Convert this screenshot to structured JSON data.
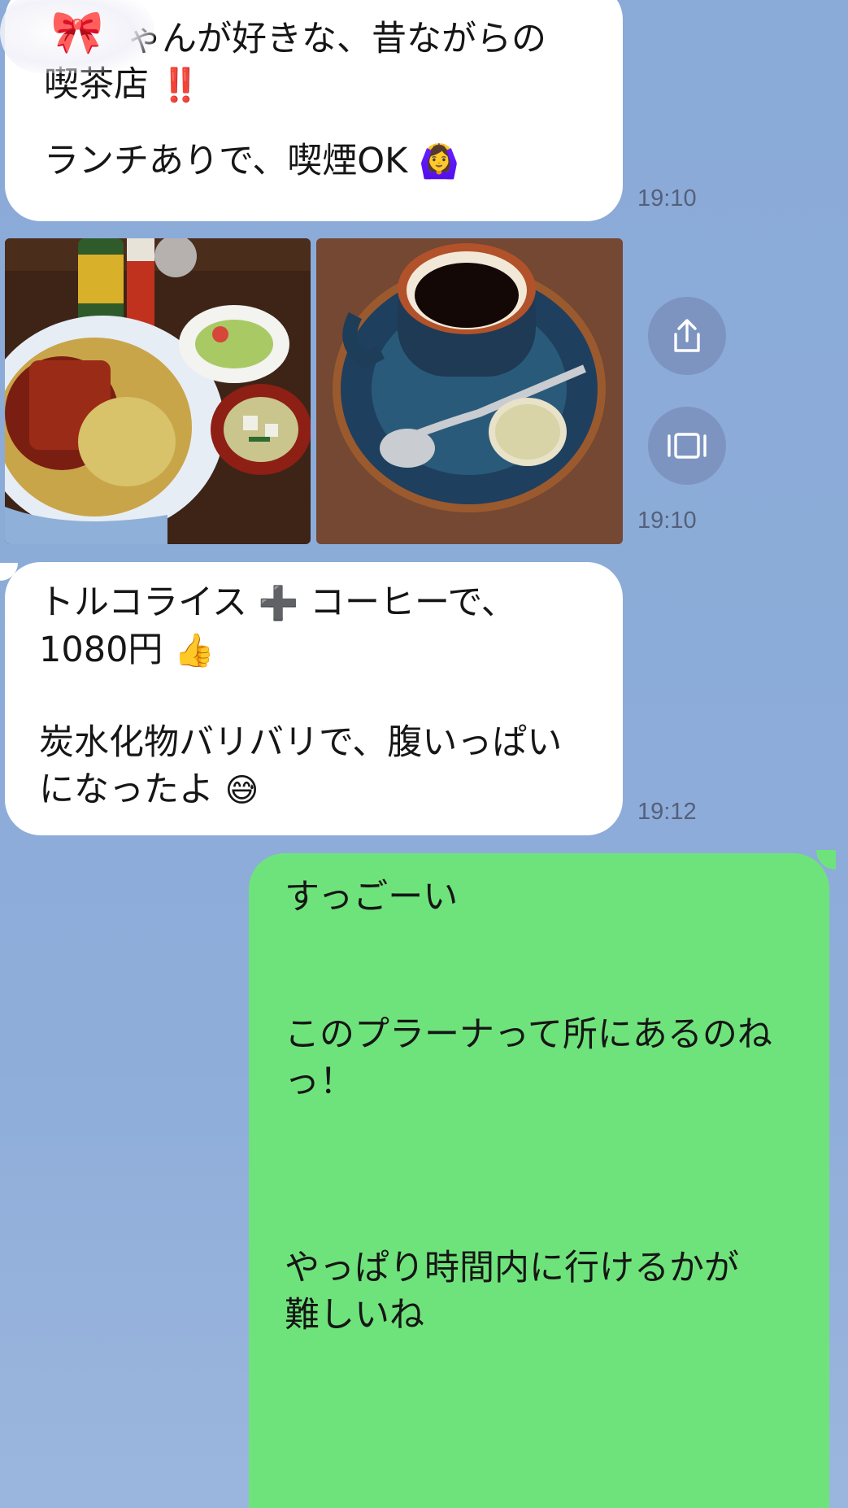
{
  "messages": [
    {
      "direction": "incoming",
      "line1": "ゃんが好きな、昔ながらの",
      "line2": "喫茶店",
      "line2_mark": "‼️",
      "line3": "ランチありで、喫煙OK",
      "line3_emoji": "🙆‍♀️",
      "sticker_emoji": "🎀",
      "time": "19:10"
    },
    {
      "direction": "incoming",
      "type": "photos",
      "photos": [
        "photo-turkish-rice",
        "photo-coffee"
      ],
      "time": "19:10"
    },
    {
      "direction": "incoming",
      "line1a": "トルコライス",
      "line1_emoji": "➕",
      "line1b": "コーヒーで、",
      "line2": "1080円",
      "line2_emoji": "👍",
      "line3": "炭水化物バリバリで、腹いっぱい",
      "line4": "になったよ",
      "line4_emoji": "😅",
      "time": "19:12"
    },
    {
      "direction": "outgoing",
      "line1": "すっごーい",
      "line2": "このプラーナって所にあるのね",
      "line3": "っ！",
      "line4": "やっぱり時間内に行けるかが",
      "line5": "難しいね"
    }
  ],
  "actions": {
    "share_icon": "share-icon",
    "expand_icon": "fullscreen-icon"
  },
  "colors": {
    "background": "#8eabd9",
    "incoming_bubble": "#ffffff",
    "outgoing_bubble": "#6fe37b",
    "timestamp": "#55607a"
  }
}
